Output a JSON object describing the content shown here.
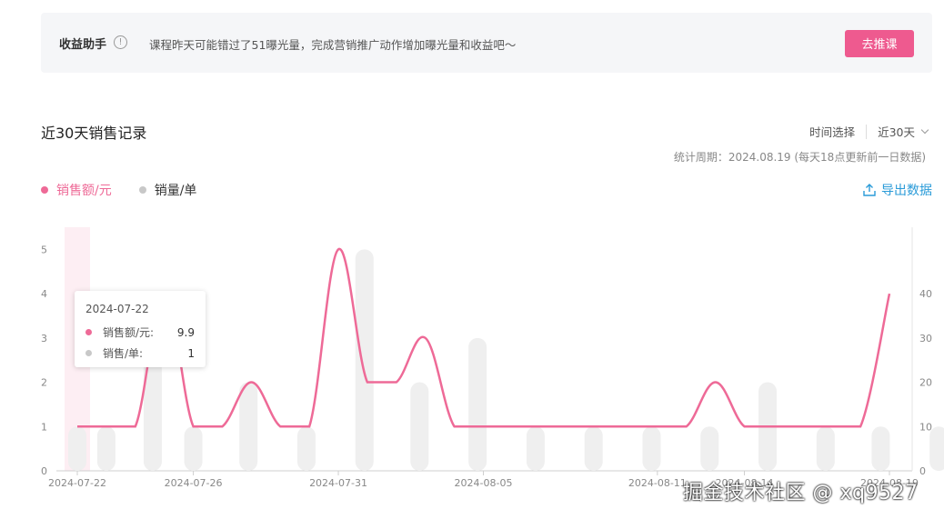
{
  "banner": {
    "title": "收益助手",
    "info_icon": "info-icon",
    "message": "课程昨天可能错过了51曝光量，完成营销推广动作增加曝光量和收益吧～",
    "button": "去推课"
  },
  "section": {
    "title": "近30天销售记录",
    "time_label": "时间选择",
    "time_value": "近30天",
    "stat_period": "统计周期：2024.08.19 (每天18点更新前一日数据)"
  },
  "legend": [
    {
      "name": "销售额/元",
      "color": "#ee6a97"
    },
    {
      "name": "销量/单",
      "color": "#c8c8c8"
    }
  ],
  "export_label": "导出数据",
  "tooltip": {
    "date": "2024-07-22",
    "rows": [
      {
        "label": "销售额/元:",
        "value": "9.9",
        "color": "#ee6a97"
      },
      {
        "label": "销售/单:",
        "value": "1",
        "color": "#c8c8c8"
      }
    ]
  },
  "watermark": "掘金技术社区 @ xq9527",
  "chart_data": {
    "type": "line",
    "x": [
      "2024-07-22",
      "2024-07-23",
      "2024-07-24",
      "2024-07-25",
      "2024-07-26",
      "2024-07-27",
      "2024-07-28",
      "2024-07-29",
      "2024-07-30",
      "2024-07-31",
      "2024-08-01",
      "2024-08-02",
      "2024-08-03",
      "2024-08-04",
      "2024-08-05",
      "2024-08-06",
      "2024-08-07",
      "2024-08-08",
      "2024-08-09",
      "2024-08-10",
      "2024-08-11",
      "2024-08-12",
      "2024-08-13",
      "2024-08-14",
      "2024-08-15",
      "2024-08-16",
      "2024-08-17",
      "2024-08-18",
      "2024-08-19"
    ],
    "x_tick_labels": [
      "2024-07-22",
      "2024-07-26",
      "2024-07-31",
      "2024-08-05",
      "2024-08-11",
      "2024-08-14",
      "2024-08-19"
    ],
    "x_tick_indices": [
      0,
      4,
      9,
      14,
      20,
      23,
      28
    ],
    "series": [
      {
        "name": "销售额/元",
        "axis": "left",
        "values": [
          1,
          1,
          1,
          4,
          1,
          1,
          2,
          1,
          1,
          5,
          2,
          2,
          3,
          1,
          1,
          1,
          1,
          1,
          1,
          1,
          1,
          1,
          2,
          1,
          1,
          1,
          1,
          1,
          4
        ],
        "color": "#ee6a97"
      },
      {
        "name": "销量/单",
        "axis": "right",
        "bar_indices": [
          0,
          2,
          4,
          6,
          8,
          10,
          12,
          14,
          16,
          18,
          20,
          22,
          24,
          26,
          28
        ],
        "values": [
          10,
          10,
          40,
          10,
          20,
          10,
          50,
          20,
          30,
          10,
          10,
          10,
          10,
          20,
          10,
          10,
          10,
          20
        ],
        "color": "#efefef"
      }
    ],
    "bar_values": [
      10,
      10,
      40,
      10,
      20,
      10,
      50,
      20,
      30,
      10,
      10,
      10,
      10,
      20,
      10,
      10,
      10,
      20
    ],
    "bar_positions": [
      0,
      1,
      2.6,
      4,
      5.9,
      7.9,
      9.9,
      11.8,
      13.8,
      15.8,
      17.8,
      19.8,
      21.8,
      23.8,
      25.8,
      27.7,
      29.7,
      31.6
    ],
    "y_left": {
      "ticks": [
        0,
        1,
        2,
        3,
        4,
        5
      ],
      "range": [
        0,
        5.5
      ]
    },
    "y_right": {
      "ticks": [
        0,
        10,
        20,
        30,
        40
      ],
      "range": [
        0,
        55
      ]
    },
    "highlight_index": 0
  }
}
